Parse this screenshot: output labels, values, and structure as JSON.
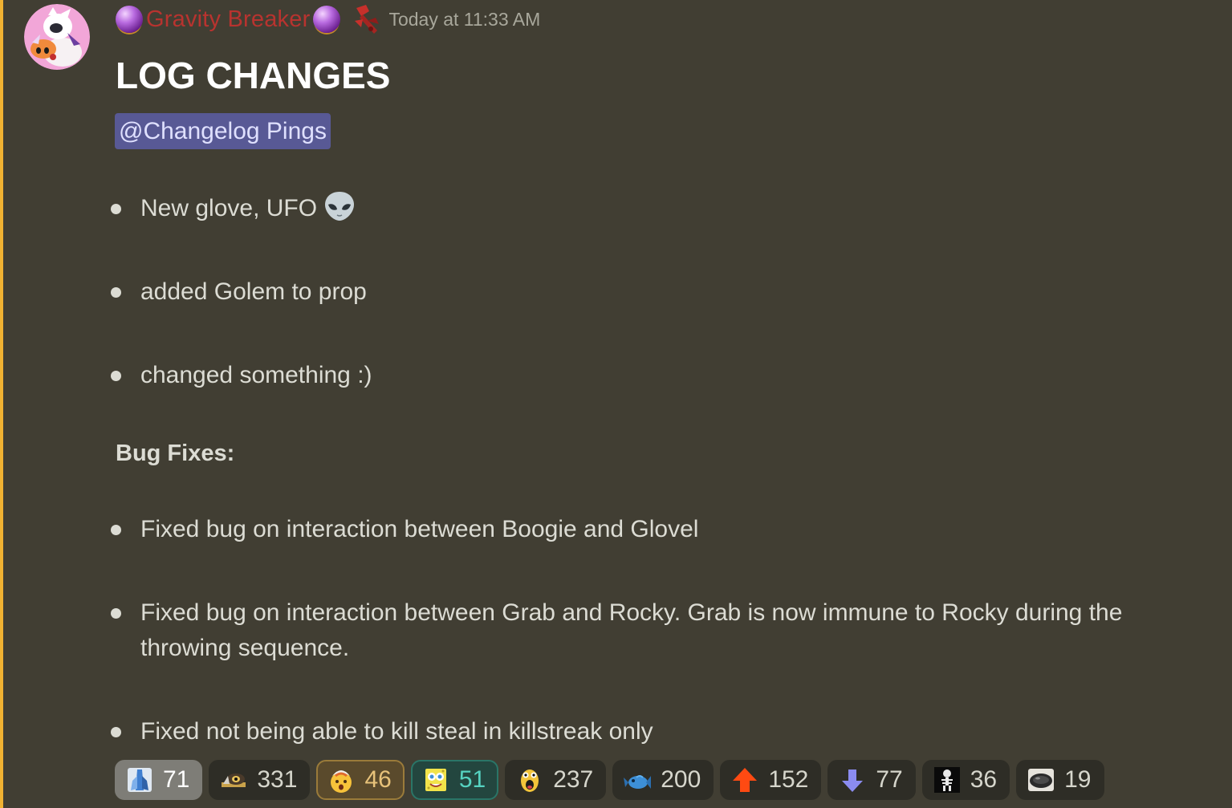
{
  "message": {
    "author": {
      "name": "Gravity Breaker",
      "avatar_icon": "avatar-pink-character",
      "prefix_icon": "crystal-ball-icon",
      "suffix_icon": "crystal-ball-icon",
      "role_icon": "red-hammer-icon",
      "name_color": "#b8332f"
    },
    "timestamp": "Today at 11:33 AM",
    "title": "LOG CHANGES",
    "mention": "@Changelog Pings",
    "changes": [
      {
        "text": "New glove, UFO",
        "emoji": "alien-icon"
      },
      {
        "text": "added Golem to prop"
      },
      {
        "text": "changed something :)"
      }
    ],
    "bugfix_heading": "Bug Fixes:",
    "bugfixes": [
      {
        "text": "Fixed bug on interaction between Boogie and Glovel"
      },
      {
        "text": "Fixed bug on interaction between Grab and Rocky. Grab is now immune to Rocky during the throwing sequence."
      },
      {
        "text": "Fixed not being able to kill steal in killstreak only"
      }
    ]
  },
  "reactions": [
    {
      "icon": "blue-figure-icon",
      "count": "71",
      "selected": true
    },
    {
      "icon": "cat-eye-icon",
      "count": "331"
    },
    {
      "icon": "exploding-head-icon",
      "count": "46",
      "highlight": "gold"
    },
    {
      "icon": "spongebob-icon",
      "count": "51",
      "highlight": "teal"
    },
    {
      "icon": "shocked-face-icon",
      "count": "237"
    },
    {
      "icon": "fish-icon",
      "count": "200"
    },
    {
      "icon": "up-arrow-icon",
      "count": "152"
    },
    {
      "icon": "down-arrow-icon",
      "count": "77"
    },
    {
      "icon": "skeleton-icon",
      "count": "36"
    },
    {
      "icon": "frying-pan-icon",
      "count": "19"
    }
  ],
  "colors": {
    "background": "#413e33",
    "accent_bar": "#f0b232",
    "mention_bg": "#585995"
  }
}
